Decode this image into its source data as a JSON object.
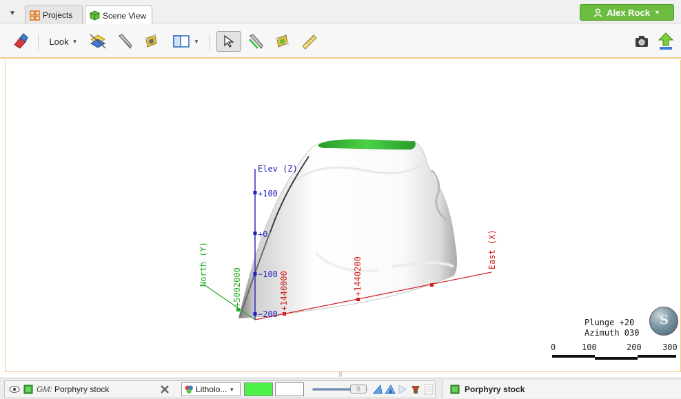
{
  "tabs": {
    "menu_caret": "▼",
    "projects_label": "Projects",
    "scene_label": "Scene View",
    "active": "Scene View"
  },
  "user": {
    "name": "Alex Rock",
    "caret": "▼",
    "color": "#6cbd3f"
  },
  "toolbar": {
    "look_label": "Look",
    "caret": "▼",
    "icons": [
      "eraser-icon",
      "look-menu",
      "slice-icon",
      "pencil-icon",
      "plane-icon",
      "layout-icon",
      "select-arrow-icon",
      "draw-line-icon",
      "surface-tool-icon",
      "ruler-icon",
      "camera-icon",
      "share-upload-icon"
    ]
  },
  "scene": {
    "axes": {
      "elev_label": "Elev (Z)",
      "north_label": "North (Y)",
      "east_label": "East (X)",
      "z_ticks": [
        "+100",
        "+0",
        "−100",
        "−200"
      ],
      "east_ticks": [
        "+1440000",
        "+1440200"
      ],
      "north_ticks": [
        "+5002000"
      ]
    },
    "colors": {
      "elev_axis": "#1f1fb8",
      "north_axis": "#22aa22",
      "east_axis": "#d41c1c",
      "top_cap": "#3fc23a"
    },
    "orientation": {
      "plunge": "Plunge +20",
      "azimuth": "Azimuth 030"
    },
    "scale_labels": [
      "0",
      "100",
      "200",
      "300"
    ]
  },
  "bottom": {
    "object_prefix": "GM:",
    "object_name": " Porphyry stock",
    "lithology_label": "Litholo...",
    "colour_primary": "#4cf24a",
    "colour_secondary": "#ffffff",
    "transparency_fraction": 0.85,
    "properties_title": "Porphyry stock"
  }
}
